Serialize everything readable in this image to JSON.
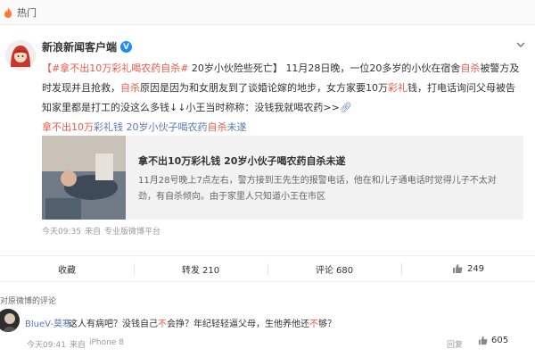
{
  "hot_bar": {
    "label": "热门",
    "icon": "flame-icon"
  },
  "post": {
    "author": "新浪新闻客户端",
    "verified_badge": "V",
    "content": {
      "hashtag_prefix": "【#拿不出",
      "hashtag_num": "10",
      "hashtag_mid": "万彩礼喝农药",
      "hashtag_red": "自杀",
      "hashtag_end": "#",
      "headline": " 20岁小伙险些死亡】",
      "body1": "11月28日晚，一位20多岁的小伙在宿舍",
      "body_red1": "自杀",
      "body2": "被警方及时发现并且抢救，",
      "body_red2": "自杀",
      "body3": "原因是因为和女朋友到了谈婚论嫁的地步，女方家要10万",
      "body_red3": "彩礼",
      "body4": "钱，打电话询问父母被告知家里都是打工的没这么多钱↓↓小王当时称称：没钱我就喝农药>>",
      "link_icon": "chain-link-icon",
      "link_red1": "拿不出10万",
      "link_mid": "彩礼钱 20岁小伙子喝农药",
      "link_red2": "自杀",
      "link_end": "未遂"
    },
    "card": {
      "title": "拿不出10万彩礼钱 20岁小伙子喝农药自杀未遂",
      "desc": "11月28号晚上7点左右，警方接到王先生的报警电话，他在和儿子通电话时觉得儿子不太对劲，有自杀倾向。由于家里人只知道小王在市区"
    },
    "meta": {
      "time": "今天09:35",
      "via": "来自",
      "source": "专业版微博平台"
    }
  },
  "actions": {
    "favorite": "收藏",
    "repost": "转发 210",
    "comment": "评论 680",
    "like": "249"
  },
  "comments_header": "对原微博的评论",
  "comment": {
    "user": "BlueV-莫寒:",
    "text_a": "这人有病吧？没钱自己",
    "text_red_a": "不",
    "text_b": "会挣？年纪轻轻逼父母，生他养他还",
    "text_red_b": "不",
    "text_c": "够？",
    "time": "今天09:41",
    "via": "来自",
    "source": "iPhone 8",
    "report": "回复",
    "likes": "605"
  },
  "colors": {
    "accent_red": "#eb5b47",
    "link_blue": "#5a7ab4",
    "verified_blue": "#1a8cff"
  }
}
